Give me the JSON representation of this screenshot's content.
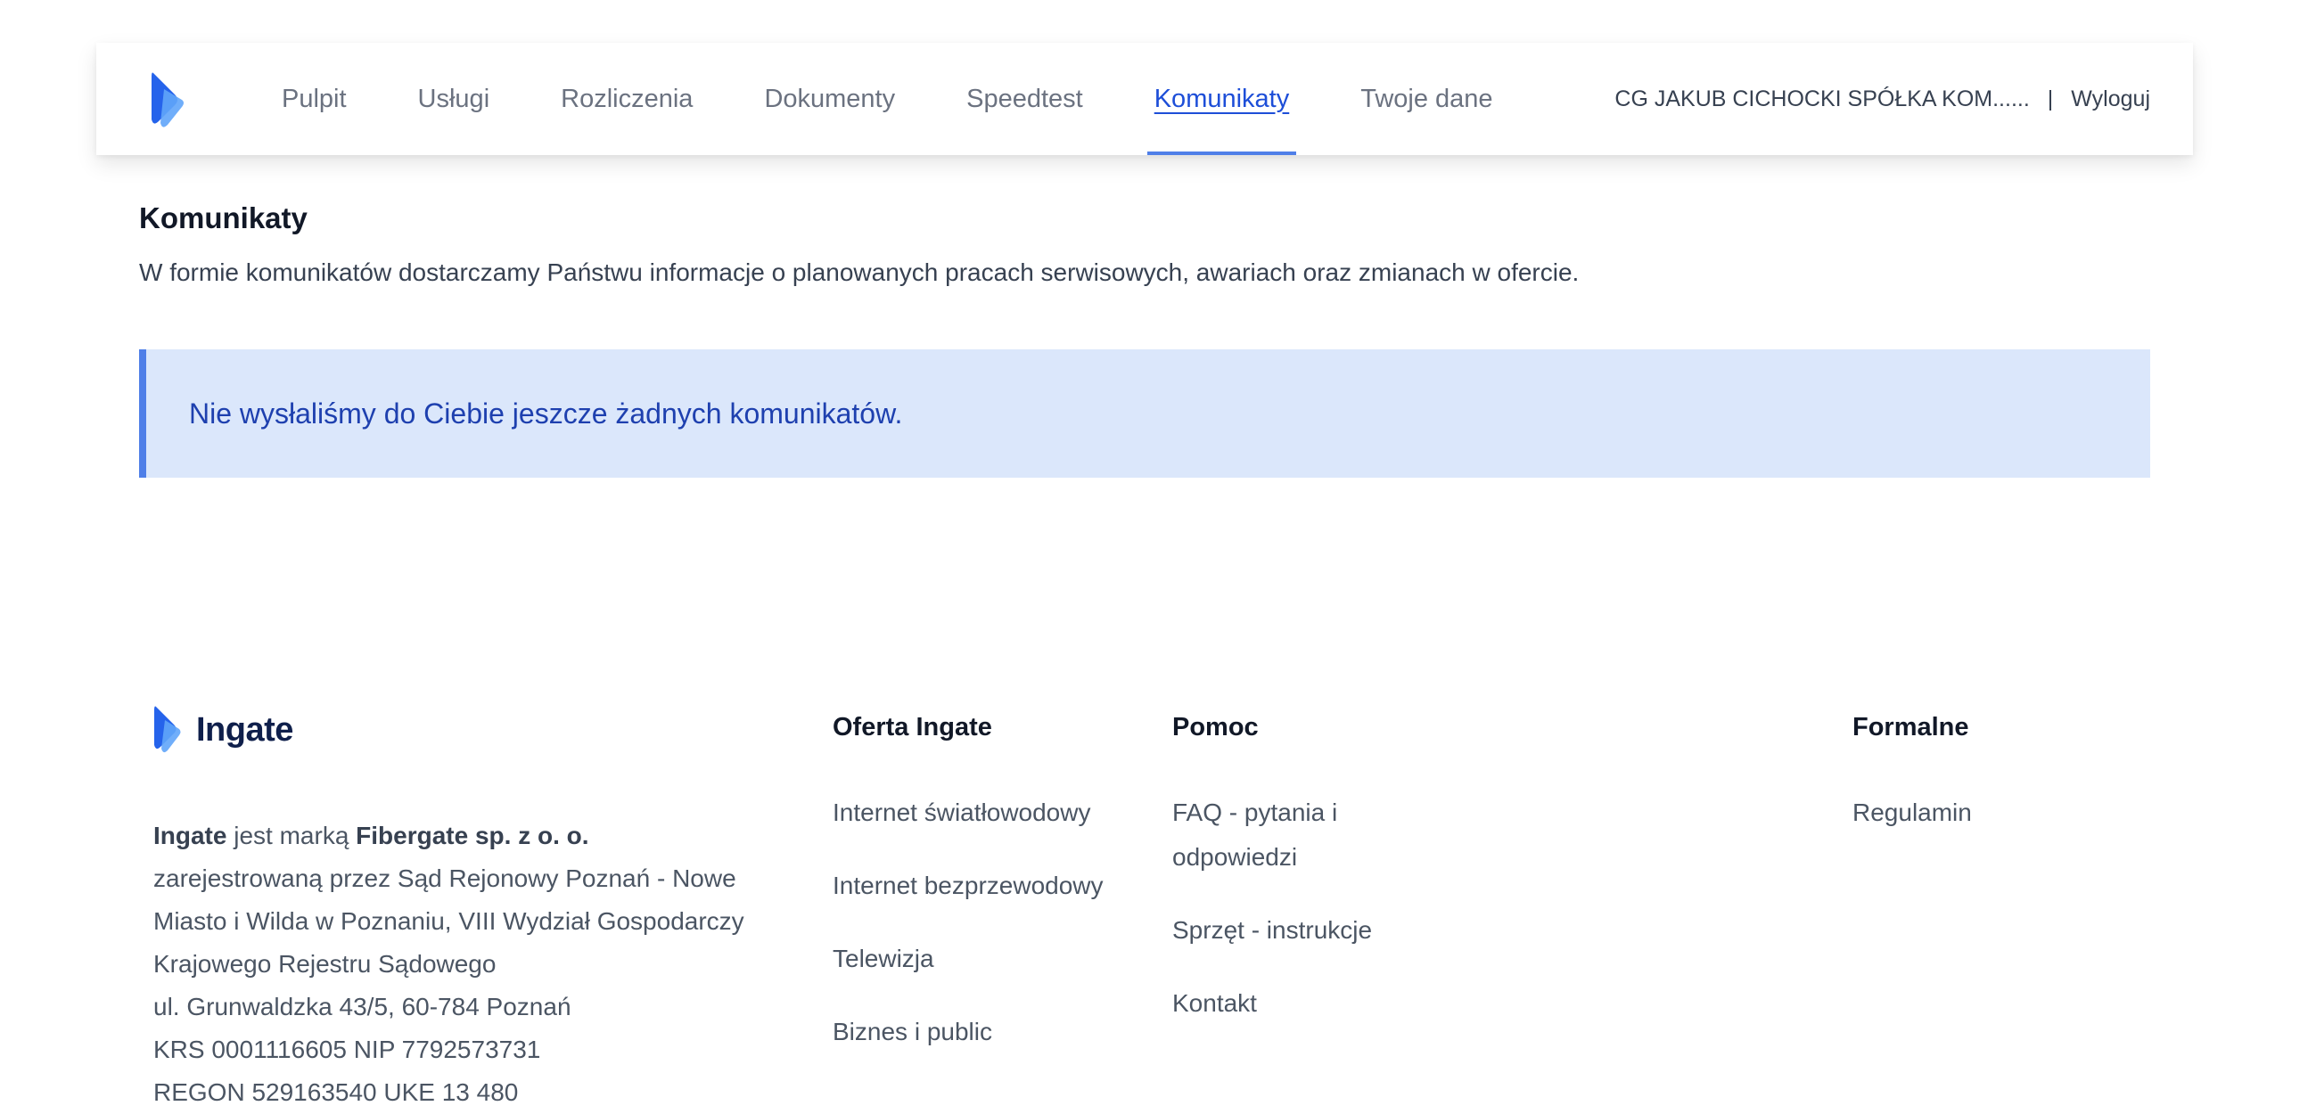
{
  "nav": {
    "items": [
      {
        "label": "Pulpit"
      },
      {
        "label": "Usługi"
      },
      {
        "label": "Rozliczenia"
      },
      {
        "label": "Dokumenty"
      },
      {
        "label": "Speedtest"
      },
      {
        "label": "Komunikaty",
        "active": true
      },
      {
        "label": "Twoje dane"
      }
    ],
    "user_name": "CG JAKUB CICHOCKI SPÓŁKA KOM......",
    "separator": "|",
    "logout": "Wyloguj",
    "logo_icon": "ingate-chevron-logo"
  },
  "main": {
    "title": "Komunikaty",
    "description": "W formie komunikatów dostarczamy Państwu informacje o planowanych pracach serwisowych, awariach oraz zmianach w ofercie.",
    "alert": "Nie wysłaliśmy do Ciebie jeszcze żadnych komunikatów."
  },
  "footer": {
    "brand": "Ingate",
    "company": {
      "brand_bold": "Ingate",
      "is_brand_of": " jest marką ",
      "company_bold": "Fibergate sp. z o. o.",
      "lines": [
        "zarejestrowaną przez Sąd Rejonowy Poznań - Nowe",
        "Miasto i Wilda w Poznaniu, VIII Wydział Gospodarczy",
        "Krajowego Rejestru Sądowego",
        "ul. Grunwaldzka 43/5, 60-784 Poznań",
        "KRS 0001116605 NIP 7792573731",
        "REGON 529163540 UKE 13 480"
      ]
    },
    "oferta": {
      "title": "Oferta Ingate",
      "items": [
        "Internet światłowodowy",
        "Internet bezprzewodowy",
        "Telewizja",
        "Biznes i public"
      ]
    },
    "pomoc": {
      "title": "Pomoc",
      "items": [
        "FAQ - pytania i odpowiedzi",
        "Sprzęt - instrukcje",
        "Kontakt"
      ]
    },
    "formalne": {
      "title": "Formalne",
      "items": [
        "Regulamin"
      ]
    }
  },
  "colors": {
    "accent": "#4f7fe8",
    "active_link": "#1d4ed8",
    "alert_bg": "#dbe7fb",
    "alert_text": "#1e40af",
    "brand_dark": "#0f1f4b"
  }
}
